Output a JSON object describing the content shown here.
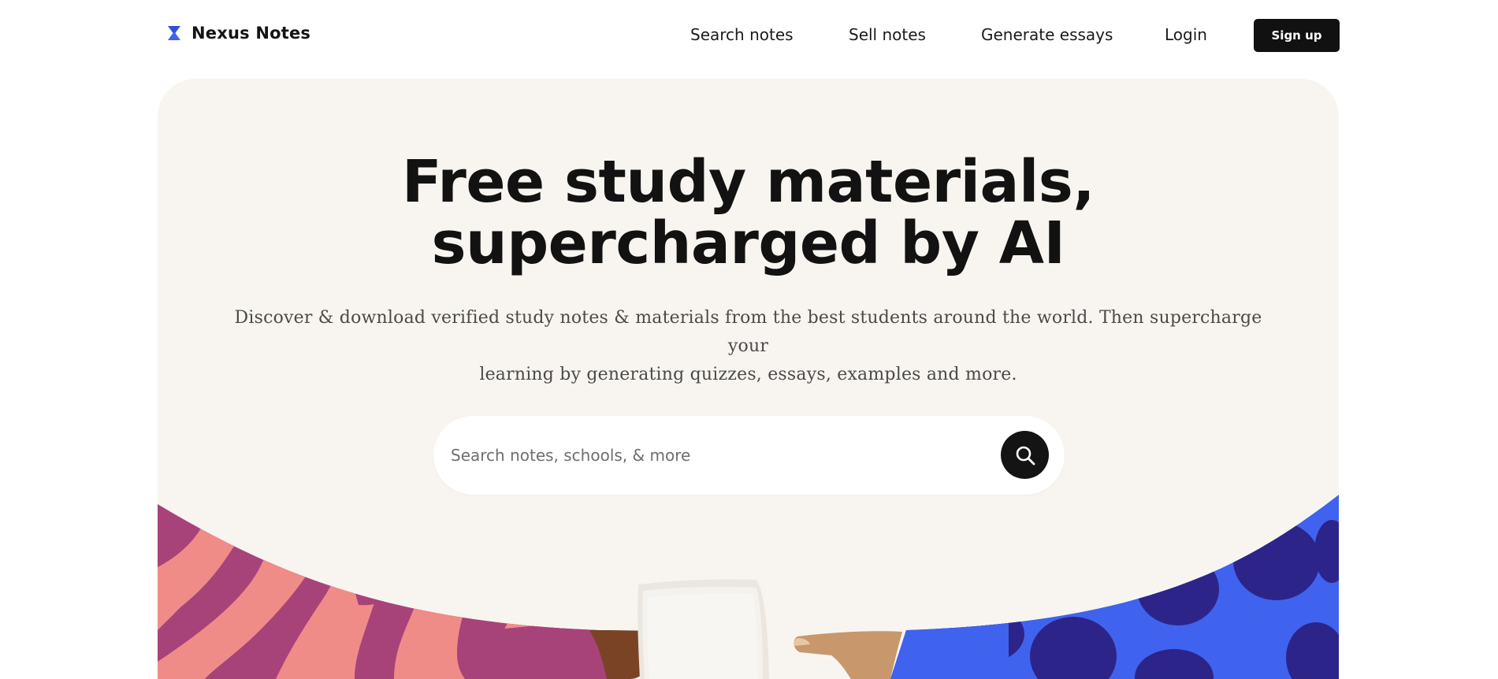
{
  "header": {
    "brand_name": "Nexus Notes",
    "logo_icon": "hourglass-logo-icon",
    "nav": [
      {
        "label": "Search notes"
      },
      {
        "label": "Sell notes"
      },
      {
        "label": "Generate essays"
      },
      {
        "label": "Login"
      }
    ],
    "signup_label": "Sign up"
  },
  "hero": {
    "headline_line1": "Free study materials,",
    "headline_line2": "supercharged by AI",
    "subtitle_line1": "Discover & download verified study notes & materials from the best students around the world. Then supercharge your",
    "subtitle_line2": "learning by generating quizzes, essays, examples and more.",
    "search": {
      "placeholder": "Search notes, schools, & more",
      "button_icon": "search-icon"
    },
    "illustration": "hands-sharing-notes-illustration"
  },
  "colors": {
    "accent_blue": "#3f63ee",
    "dark_navy": "#2d2489",
    "magenta": "#a84379",
    "pink": "#ef8c88",
    "hero_bg": "#f8f5f0",
    "dark_button": "#111111"
  }
}
